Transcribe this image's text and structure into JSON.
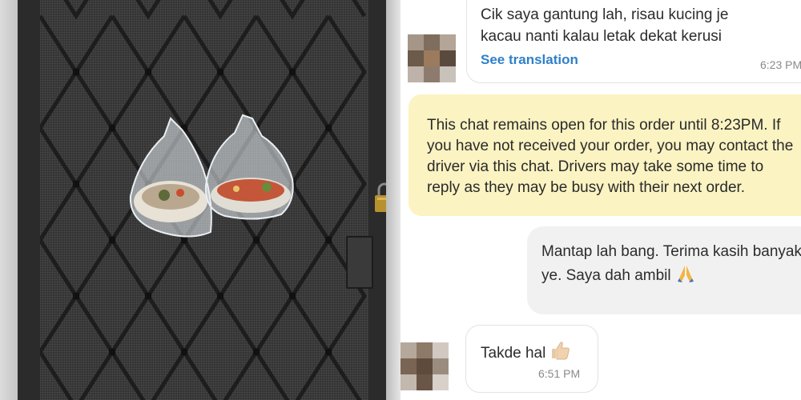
{
  "chat": {
    "messages": [
      {
        "sender": "driver",
        "lines": [
          "Cik saya gantung lah, risau kucing je",
          "kacau nanti kalau letak dekat kerusi"
        ],
        "translate_link": "See translation",
        "time": "6:23 PM"
      },
      {
        "sender": "system",
        "text": "This chat remains open for this order until 8:23PM. If\nyou have not received your order, you may contact the\ndriver via this chat. Drivers may take some time to\nreply as they may be busy with their next order."
      },
      {
        "sender": "me",
        "text": "Mantap lah bang. Terima kasih banyak\nye. Saya dah ambil",
        "emoji": "praying-hands"
      },
      {
        "sender": "driver",
        "text": "Takde hal",
        "emoji": "thumbs-up",
        "time": "6:51 PM"
      }
    ]
  },
  "icons": [
    "blurred-avatar",
    "praying-hands-emoji",
    "thumbs-up-emoji",
    "padlock"
  ],
  "colors": {
    "link": "#2f80c8",
    "system_note_bg": "#fbf3c2",
    "own_bubble_bg": "#f1f1f1",
    "timestamp": "#8a8a8a"
  }
}
